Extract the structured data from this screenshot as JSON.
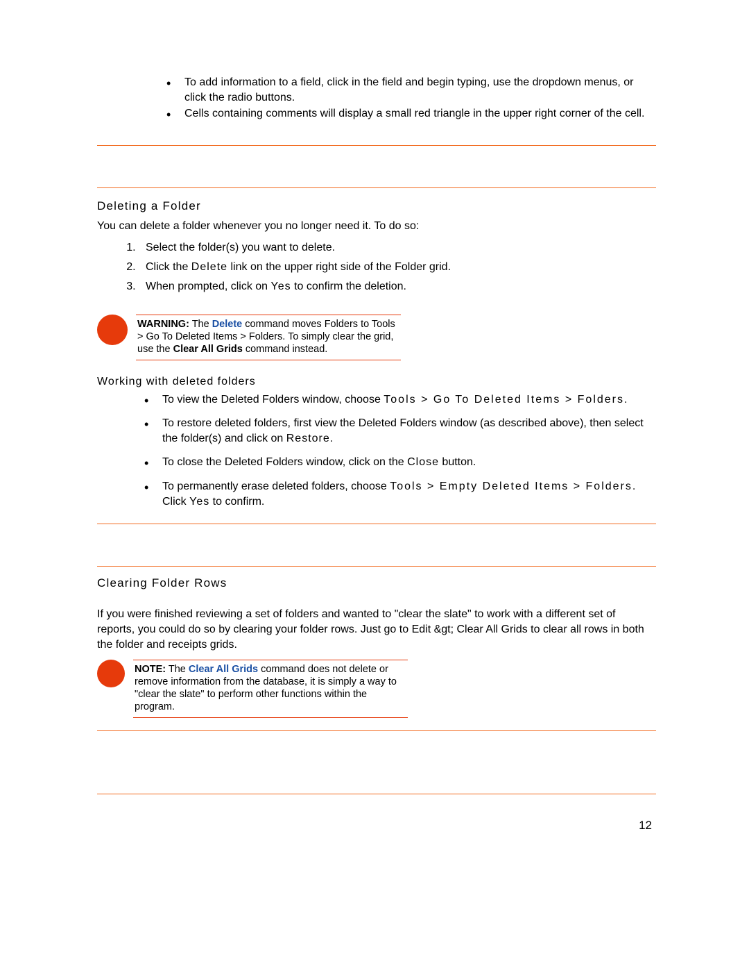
{
  "intro_bullets": [
    "To add information to a field, click in the field and begin typing, use the dropdown menus, or click the radio buttons.",
    "Cells containing comments will display a small red triangle in the upper right corner of the cell."
  ],
  "section1": {
    "heading": "Deleting a Folder",
    "intro": "You can delete a folder whenever you no longer need it. To do so:",
    "steps": {
      "s1": "Select the folder(s) you want to delete.",
      "s2_a": "Click the ",
      "s2_b": "Delete",
      "s2_c": " link on the upper right side of the Folder grid.",
      "s3_a": "When prompted, click on ",
      "s3_b": "Yes",
      "s3_c": " to confirm the deletion."
    },
    "warning": {
      "label": "WARNING:",
      "t1": " The ",
      "cmd1": "Delete",
      "t2": " command moves Folders to Tools > Go To Deleted Items > Folders. To simply clear the grid, use the ",
      "cmd2": "Clear All Grids",
      "t3": " command instead."
    },
    "sub_heading": "Working with deleted folders",
    "bullets": {
      "b1_a": "To view the Deleted Folders window, choose ",
      "b1_b": "Tools > Go To Deleted Items > Folders",
      "b1_c": ".",
      "b2_a": "To restore deleted folders, first view the Deleted Folders window (as described above), then select the folder(s) and click on ",
      "b2_b": "Restore",
      "b2_c": ".",
      "b3_a": "To close the Deleted Folders window, click on the ",
      "b3_b": "Close",
      "b3_c": " button.",
      "b4_a": "To permanently erase deleted folders, choose ",
      "b4_b": "Tools > Empty Deleted Items > Folders",
      "b4_c": ". Click ",
      "b4_d": "Yes",
      "b4_e": " to confirm."
    }
  },
  "section2": {
    "heading": "Clearing Folder Rows",
    "body": "If you were finished reviewing a set of folders and wanted to \"clear the slate\" to work with a different set of reports, you could do so by clearing your folder rows. Just go to Edit &gt; Clear All Grids to clear all rows in both the folder and receipts grids.",
    "note": {
      "label": "NOTE:",
      "t1": " The ",
      "cmd1": "Clear All Grids",
      "t2": " command does not delete or remove information from the database, it is simply a way to \"clear the slate\" to perform other functions within the program."
    }
  },
  "page_number": "12"
}
